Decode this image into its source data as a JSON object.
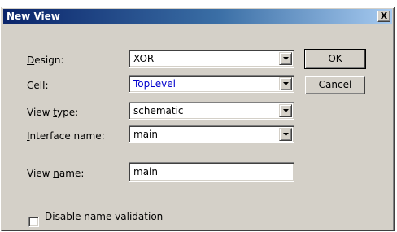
{
  "window": {
    "title": "New View",
    "close_glyph": "X"
  },
  "fields": {
    "design": {
      "label_pre": "",
      "label_mnemonic": "D",
      "label_post": "esign:",
      "value": "XOR"
    },
    "cell": {
      "label_pre": "",
      "label_mnemonic": "C",
      "label_post": "ell:",
      "value": "TopLevel"
    },
    "view_type": {
      "label_pre": "View ",
      "label_mnemonic": "t",
      "label_post": "ype:",
      "value": "schematic"
    },
    "interface_name": {
      "label_pre": "",
      "label_mnemonic": "I",
      "label_post": "nterface name:",
      "value": "main"
    },
    "view_name": {
      "label_pre": "View ",
      "label_mnemonic": "n",
      "label_post": "ame:",
      "value": "main"
    }
  },
  "buttons": {
    "ok": "OK",
    "cancel": "Cancel"
  },
  "options": {
    "disable_validation": {
      "label_pre": "Dis",
      "label_mnemonic": "a",
      "label_post": "ble name validation",
      "checked": false
    }
  },
  "colors": {
    "title_start": "#0a246a",
    "title_end": "#a6caf0",
    "dialog_face": "#d4d0c8",
    "highlight_text": "#0000cc"
  }
}
